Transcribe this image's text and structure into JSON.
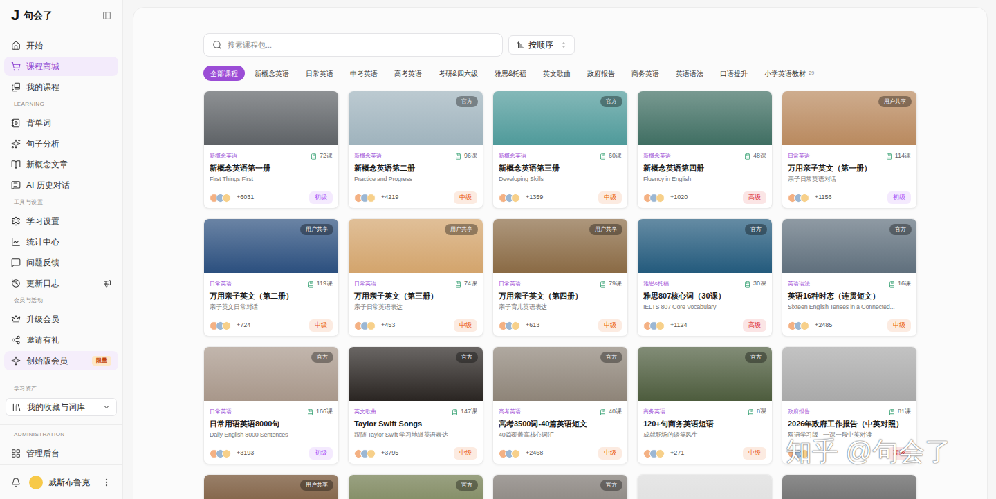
{
  "sidebar": {
    "logo": {
      "mark": "J",
      "name": "句会了"
    },
    "sections": [
      {
        "label": null,
        "items": [
          {
            "label": "开始",
            "selected": false
          },
          {
            "label": "课程商城",
            "selected": true
          },
          {
            "label": "我的课程",
            "selected": false
          }
        ]
      },
      {
        "label": "LEARNING",
        "items": [
          {
            "label": "背单词",
            "selected": false
          },
          {
            "label": "句子分析",
            "selected": false
          },
          {
            "label": "新概念文章",
            "selected": false
          },
          {
            "label": "AI 历史对话",
            "selected": false
          }
        ]
      },
      {
        "label": "工具与设置",
        "items": [
          {
            "label": "学习设置",
            "selected": false
          },
          {
            "label": "统计中心",
            "selected": false
          },
          {
            "label": "问题反馈",
            "selected": false
          },
          {
            "label": "更新日志",
            "selected": false,
            "announcement": true
          }
        ]
      },
      {
        "label": "会员与活动",
        "items": [
          {
            "label": "升级会员",
            "selected": false
          },
          {
            "label": "邀请有礼",
            "selected": false
          },
          {
            "label": "创始版会员",
            "selected": false,
            "highlighted": true,
            "badge": "限量"
          }
        ]
      },
      {
        "label": "学习资产",
        "items": [
          {
            "label": "我的收藏与词库",
            "selected": false,
            "dropdown": true,
            "expanded": false
          }
        ]
      },
      {
        "label": "ADMINISTRATION",
        "items": [
          {
            "label": "管理后台",
            "selected": false
          }
        ]
      }
    ],
    "user": {
      "name": "威斯布鲁克"
    }
  },
  "search": {
    "placeholder": "搜索课程包..."
  },
  "sort": {
    "label": "按顺序"
  },
  "categories": [
    {
      "label": "全部课程",
      "selected": true
    },
    {
      "label": "新概念英语",
      "selected": false
    },
    {
      "label": "日常英语",
      "selected": false
    },
    {
      "label": "中考英语",
      "selected": false
    },
    {
      "label": "高考英语",
      "selected": false
    },
    {
      "label": "考研&四六级",
      "selected": false
    },
    {
      "label": "雅思&托福",
      "selected": false
    },
    {
      "label": "英文歌曲",
      "selected": false
    },
    {
      "label": "政府报告",
      "selected": false
    },
    {
      "label": "商务英语",
      "selected": false
    },
    {
      "label": "英语语法",
      "selected": false
    },
    {
      "label": "口语提升",
      "selected": false
    },
    {
      "label": "小学英语教材",
      "selected": false,
      "count": "29"
    }
  ],
  "cards": [
    {
      "category": "新概念英语",
      "lessons": "72课",
      "title": "新概念英语第一册",
      "subtitle": "First Things First",
      "learners": "+6031",
      "difficulty": {
        "label": "初级",
        "color": "#a855f7"
      },
      "badge": null,
      "color": "#5e6266",
      "partial": false
    },
    {
      "category": "新概念英语",
      "lessons": "96课",
      "title": "新概念英语第二册",
      "subtitle": "Practice and Progress",
      "learners": "+4219",
      "difficulty": {
        "label": "中级",
        "color": "#ea580c"
      },
      "badge": "官方",
      "color": "#9fb3bd",
      "partial": false
    },
    {
      "category": "新概念英语",
      "lessons": "60课",
      "title": "新概念英语第三册",
      "subtitle": "Developing Skills",
      "learners": "+1359",
      "difficulty": {
        "label": "中级",
        "color": "#ea580c"
      },
      "badge": "官方",
      "color": "#4f9a9a",
      "partial": false
    },
    {
      "category": "新概念英语",
      "lessons": "48课",
      "title": "新概念英语第四册",
      "subtitle": "Fluency in English",
      "learners": "+1020",
      "difficulty": {
        "label": "高级",
        "color": "#dc2626"
      },
      "badge": null,
      "color": "#3f6e62",
      "partial": false
    },
    {
      "category": "日常英语",
      "lessons": "114课",
      "title": "万用亲子英文（第一册）",
      "subtitle": "亲子日常英语对话",
      "learners": "+1156",
      "difficulty": {
        "label": "初级",
        "color": "#a855f7"
      },
      "badge": "用户共享",
      "color": "#b9895e",
      "partial": false
    },
    {
      "category": "日常英语",
      "lessons": "119课",
      "title": "万用亲子英文（第二册）",
      "subtitle": "亲子英文日常对话",
      "learners": "+724",
      "difficulty": {
        "label": "中级",
        "color": "#ea580c"
      },
      "badge": "用户共享",
      "color": "#2b4f7e",
      "partial": false
    },
    {
      "category": "日常英语",
      "lessons": "74课",
      "title": "万用亲子英文（第三册）",
      "subtitle": "亲子日常英语表达",
      "learners": "+453",
      "difficulty": {
        "label": "中级",
        "color": "#ea580c"
      },
      "badge": "用户共享",
      "color": "#d3a46c",
      "partial": false
    },
    {
      "category": "日常英语",
      "lessons": "79课",
      "title": "万用亲子英文（第四册）",
      "subtitle": "亲子育儿英语表达",
      "learners": "+613",
      "difficulty": {
        "label": "中级",
        "color": "#ea580c"
      },
      "badge": "用户共享",
      "color": "#8a6a44",
      "partial": false
    },
    {
      "category": "雅思&托福",
      "lessons": "30课",
      "title": "雅思807核心词（30课）",
      "subtitle": "IELTS 807 Core Vocabulary",
      "learners": "+1124",
      "difficulty": {
        "label": "高级",
        "color": "#dc2626"
      },
      "badge": "官方",
      "color": "#235a7c",
      "partial": false
    },
    {
      "category": "英语语法",
      "lessons": "16课",
      "title": "英语16种时态（连贯短文）",
      "subtitle": "Sixteen English Tenses in a Connected...",
      "learners": "+2485",
      "difficulty": {
        "label": "中级",
        "color": "#ea580c"
      },
      "badge": "官方",
      "color": "#5f6f7c",
      "partial": false
    },
    {
      "category": "日常英语",
      "lessons": "166课",
      "title": "日常用语英语8000句",
      "subtitle": "Daily English 8000 Sentences",
      "learners": "+3193",
      "difficulty": {
        "label": "初级",
        "color": "#a855f7"
      },
      "badge": "官方",
      "color": "#a8978a",
      "partial": false
    },
    {
      "category": "英文歌曲",
      "lessons": "147课",
      "title": "Taylor Swift Songs",
      "subtitle": "跟随 Taylor Swift 学习地道英语表达",
      "learners": "+3795",
      "difficulty": {
        "label": "中级",
        "color": "#ea580c"
      },
      "badge": "官方",
      "color": "#2a2522",
      "partial": false
    },
    {
      "category": "高考英语",
      "lessons": "40课",
      "title": "高考3500词-40篇英语短文",
      "subtitle": "40篇覆盖高核心词汇",
      "learners": "+2468",
      "difficulty": {
        "label": "中级",
        "color": "#ea580c"
      },
      "badge": "官方",
      "color": "#8e8478",
      "partial": false
    },
    {
      "category": "商务英语",
      "lessons": "8课",
      "title": "120+句商务英语短语",
      "subtitle": "成就职场的谈笑风生",
      "learners": "+271",
      "difficulty": {
        "label": "中级",
        "color": "#ea580c"
      },
      "badge": "官方",
      "color": "#4d5c3d",
      "partial": false
    },
    {
      "category": "政府报告",
      "lessons": "81课",
      "title": "2026年政府工作报告（中英对照）",
      "subtitle": "双语学习版 · 一课一段中英对读",
      "learners": null,
      "difficulty": {
        "label": "高级",
        "color": "#dc2626"
      },
      "badge": null,
      "color": "#a9a9a9",
      "partial": false
    },
    {
      "badge": "用户共享",
      "color": "#6e4a2a",
      "partial": true
    },
    {
      "badge": "官方",
      "color": "#6f7a4c",
      "partial": true
    },
    {
      "badge": "官方",
      "color": "#7c7670",
      "partial": true
    },
    {
      "badge": null,
      "color": "#dcdcdc",
      "partial": true
    },
    {
      "badge": null,
      "color": "#5c5c5c",
      "partial": true
    }
  ],
  "watermark": "知乎 @句会了"
}
